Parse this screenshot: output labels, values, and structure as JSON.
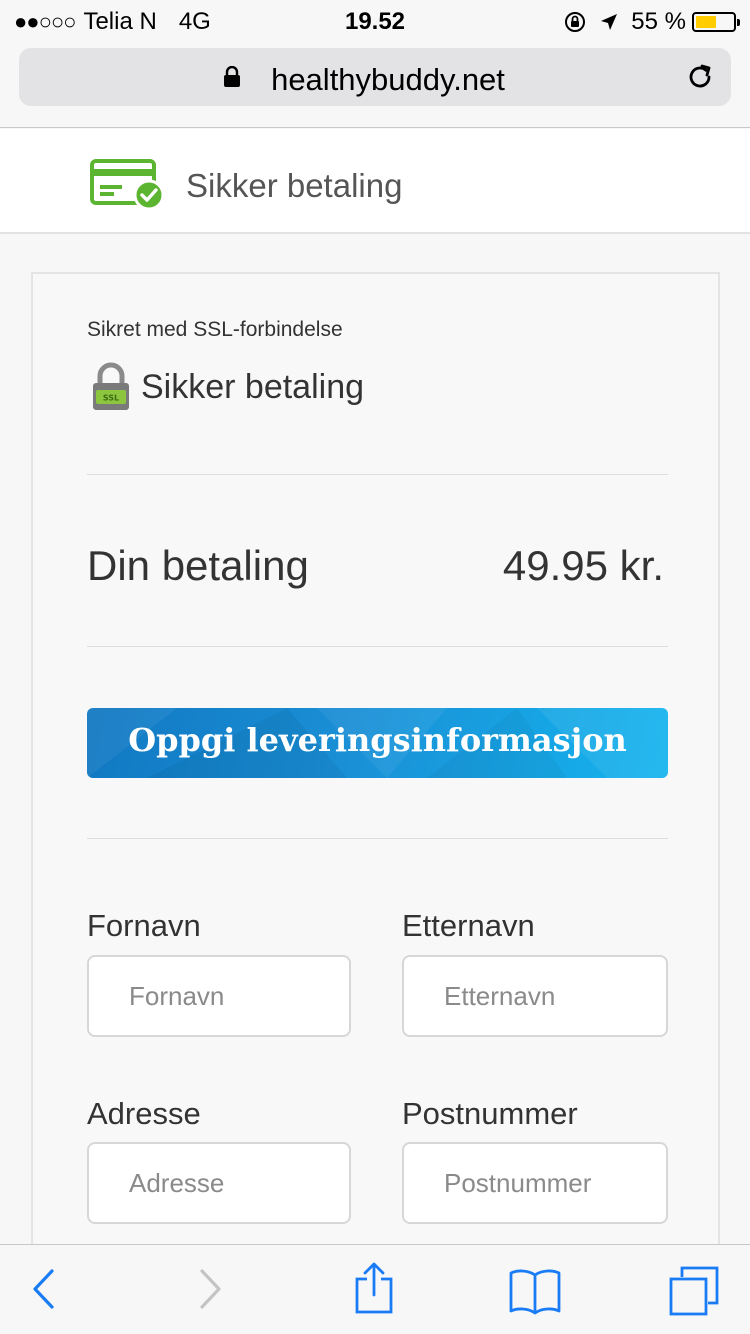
{
  "status_bar": {
    "signal": "●●○○○",
    "carrier": "Telia N",
    "network": "4G",
    "time": "19.52",
    "battery_percent": "55 %",
    "battery_level": 0.55,
    "battery_color": "#ffcc00"
  },
  "browser": {
    "url": "healthybuddy.net"
  },
  "header": {
    "title": "Sikker betaling",
    "icon_color": "#5bb531"
  },
  "card": {
    "ssl_note": "Sikret med SSL-forbindelse",
    "ssl_title": "Sikker betaling",
    "ssl_badge": "SSL",
    "payment_label": "Din betaling",
    "payment_amount": "49.95 kr.",
    "banner_text": "Oppgi leveringsinformasjon",
    "fields": {
      "first_name": {
        "label": "Fornavn",
        "placeholder": "Fornavn"
      },
      "last_name": {
        "label": "Etternavn",
        "placeholder": "Etternavn"
      },
      "address": {
        "label": "Adresse",
        "placeholder": "Adresse"
      },
      "postal_code": {
        "label": "Postnummer",
        "placeholder": "Postnummer"
      }
    }
  },
  "toolbar": {
    "accent_color": "#1a7cf5",
    "items": [
      "back-icon",
      "forward-icon",
      "share-icon",
      "bookmarks-icon",
      "tabs-icon"
    ]
  }
}
